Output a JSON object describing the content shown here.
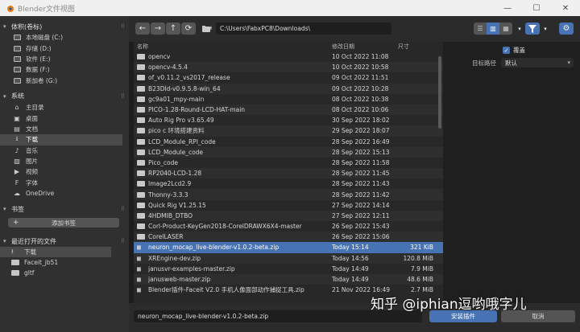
{
  "window": {
    "title": "Blender文件视图",
    "minimize": "—",
    "maximize": "☐",
    "close": "✕"
  },
  "sidebar": {
    "volumes_header": "体积(卷标)",
    "volumes": [
      {
        "label": "本地磁盘 (C:)",
        "icon": "drive-icon"
      },
      {
        "label": "存储 (D:)",
        "icon": "drive-icon"
      },
      {
        "label": "软件 (E:)",
        "icon": "drive-icon"
      },
      {
        "label": "数据 (F:)",
        "icon": "drive-icon"
      },
      {
        "label": "新加卷 (G:)",
        "icon": "drive-icon"
      }
    ],
    "system_header": "系统",
    "system": [
      {
        "label": "主目录",
        "icon": "home-icon",
        "glyph": "⌂"
      },
      {
        "label": "桌面",
        "icon": "desktop-icon",
        "glyph": "▣"
      },
      {
        "label": "文档",
        "icon": "document-icon",
        "glyph": "▤"
      },
      {
        "label": "下载",
        "icon": "download-icon",
        "glyph": "⭳",
        "active": true
      },
      {
        "label": "音乐",
        "icon": "music-icon",
        "glyph": "♪"
      },
      {
        "label": "图片",
        "icon": "image-icon",
        "glyph": "▨"
      },
      {
        "label": "视频",
        "icon": "video-icon",
        "glyph": "▶"
      },
      {
        "label": "字体",
        "icon": "font-icon",
        "glyph": "F"
      },
      {
        "label": "OneDrive",
        "icon": "cloud-icon",
        "glyph": "☁"
      }
    ],
    "bookmarks_header": "书签",
    "add_bookmark": "添加书签",
    "recent_header": "最近打开的文件",
    "recent": [
      {
        "label": "下载",
        "icon": "download-icon",
        "active": true
      },
      {
        "label": "Faceit_jb51",
        "icon": "folder-icon"
      },
      {
        "label": "gltf",
        "icon": "folder-icon"
      }
    ]
  },
  "toolbar": {
    "back": "←",
    "forward": "→",
    "parent": "↑",
    "refresh": "⟳",
    "new_folder": "+",
    "path": "C:\\Users\\FabxPC8\\Downloads\\"
  },
  "list": {
    "col_name": "名称",
    "col_date": "修改日期",
    "col_size": "尺寸",
    "rows": [
      {
        "name": "opencv",
        "date": "10 Oct 2022 11:08",
        "size": "",
        "type": "folder"
      },
      {
        "name": "opencv-4.5.4",
        "date": "10 Oct 2022 10:58",
        "size": "",
        "type": "folder"
      },
      {
        "name": "of_v0.11.2_vs2017_release",
        "date": "09 Oct 2022 11:51",
        "size": "",
        "type": "folder"
      },
      {
        "name": "B23DId-v0.9.5.8-win_64",
        "date": "09 Oct 2022 10:28",
        "size": "",
        "type": "folder"
      },
      {
        "name": "gc9a01_mpy-main",
        "date": "08 Oct 2022 10:38",
        "size": "",
        "type": "folder"
      },
      {
        "name": "PICO-1.28-Round-LCD-HAT-main",
        "date": "08 Oct 2022 10:06",
        "size": "",
        "type": "folder"
      },
      {
        "name": "Auto Rig Pro v3.65.49",
        "date": "30 Sep 2022 18:02",
        "size": "",
        "type": "folder"
      },
      {
        "name": "pico c 环境搭建资料",
        "date": "29 Sep 2022 18:07",
        "size": "",
        "type": "folder"
      },
      {
        "name": "LCD_Module_RPI_code",
        "date": "28 Sep 2022 16:49",
        "size": "",
        "type": "folder"
      },
      {
        "name": "LCD_Module_code",
        "date": "28 Sep 2022 15:13",
        "size": "",
        "type": "folder"
      },
      {
        "name": "Pico_code",
        "date": "28 Sep 2022 11:58",
        "size": "",
        "type": "folder"
      },
      {
        "name": "RP2040-LCD-1.28",
        "date": "28 Sep 2022 11:45",
        "size": "",
        "type": "folder"
      },
      {
        "name": "Image2Lcd2.9",
        "date": "28 Sep 2022 11:43",
        "size": "",
        "type": "folder"
      },
      {
        "name": "Thonny-3.3.3",
        "date": "28 Sep 2022 11:42",
        "size": "",
        "type": "folder"
      },
      {
        "name": "Quick Rig V1.25.15",
        "date": "27 Sep 2022 14:14",
        "size": "",
        "type": "folder"
      },
      {
        "name": "4HDMIB_DTBO",
        "date": "27 Sep 2022 12:11",
        "size": "",
        "type": "folder"
      },
      {
        "name": "Corl-Product-KeyGen2018-CorelDRAWX6X4-master",
        "date": "26 Sep 2022 15:43",
        "size": "",
        "type": "folder"
      },
      {
        "name": "CorelLASER",
        "date": "26 Sep 2022 15:06",
        "size": "",
        "type": "folder"
      },
      {
        "name": "neuron_mocap_live-blender-v1.0.2-beta.zip",
        "date": "Today 15:14",
        "size": "321 KiB",
        "type": "zip",
        "selected": true
      },
      {
        "name": "XREngine-dev.zip",
        "date": "Today 14:56",
        "size": "120.8 MiB",
        "type": "zip"
      },
      {
        "name": "janusvr-examples-master.zip",
        "date": "Today 14:49",
        "size": "7.9 MiB",
        "type": "zip"
      },
      {
        "name": "janusweb-master.zip",
        "date": "Today 14:49",
        "size": "48.6 MiB",
        "type": "zip"
      },
      {
        "name": "Blender插件-Faceit V2.0 手机人像面部动作捕捉工具.zip",
        "date": "21 Nov 2022 16:49",
        "size": "2.7 MiB",
        "type": "zip"
      }
    ]
  },
  "options": {
    "overwrite_label": "覆盖",
    "target_path_label": "目标路径",
    "target_path_value": "默认"
  },
  "bottom": {
    "filename": "neuron_mocap_live-blender-v1.0.2-beta.zip",
    "install": "安装插件",
    "cancel": "取消"
  },
  "watermark": "知乎 @iphian逗哟哦字儿",
  "colors": {
    "accent": "#4772b3",
    "background": "#1d1d1d"
  }
}
